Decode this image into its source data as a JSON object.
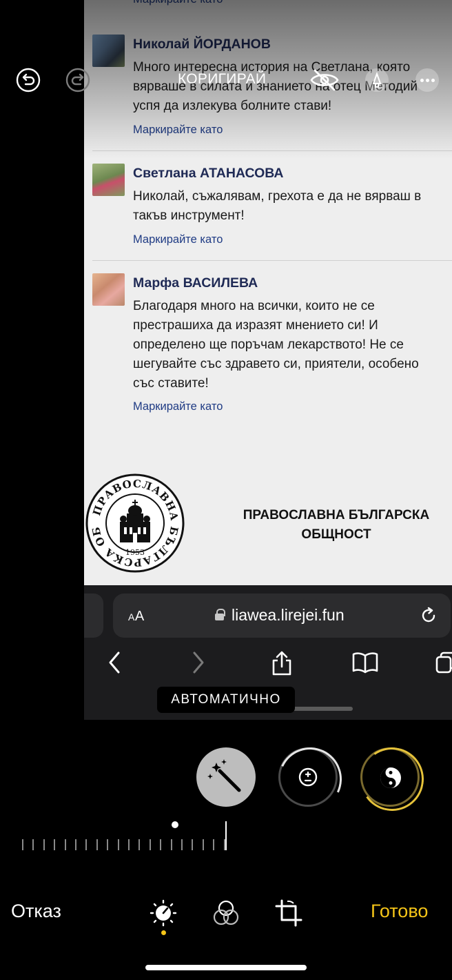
{
  "photo": {
    "top_mark": "Маркирайте като",
    "comments": [
      {
        "name": "Николай ЙОРДАНОВ",
        "lines": [
          "Много интересна история на Светлана, която",
          "вярваше в силата и знанието на отец Методий",
          "успя да излекува болните стави!"
        ],
        "mark": "Маркирайте като"
      },
      {
        "name": "Светлана АТАНАСОВА",
        "lines": [
          "Николай, съжалявам, грехота е да не вярваш в",
          "такъв инструмент!"
        ],
        "mark": "Маркирайте като"
      },
      {
        "name": "Марфа ВАСИЛЕВА",
        "lines": [
          "Благодаря много на всички, които не се",
          "престрашиха да изразят мнението си! И",
          "определено ще поръчам лекарството! Не се",
          "шегувайте със здравето си, приятели, особено",
          "със ставите!"
        ],
        "mark": "Маркирайте като"
      }
    ],
    "footer": {
      "title_line1": "ПРАВОСЛАВНА БЪЛГАРСКА",
      "title_line2": "ОБЩНОСТ",
      "logo_text": "ПРАВОСЛАВНА БЪЛГАРСКА ОБЩНОСТ",
      "logo_year": "1953"
    },
    "safari": {
      "text_size_label": "AA",
      "url": "liawea.lirejei.fun",
      "icons": [
        "back-icon",
        "forward-icon",
        "share-icon",
        "bookmarks-icon",
        "tabs-icon"
      ]
    }
  },
  "editor": {
    "top_label": "КОРИГИРАЙ",
    "auto_badge": "АВТОМАТИЧНО",
    "cancel_label": "Отказ",
    "done_label": "Готово",
    "adjustments": [
      "auto-enhance",
      "exposure",
      "brilliance"
    ],
    "tools": [
      "adjust",
      "filters",
      "crop"
    ],
    "colors": {
      "accent": "#f5c518",
      "background": "#000000"
    }
  }
}
